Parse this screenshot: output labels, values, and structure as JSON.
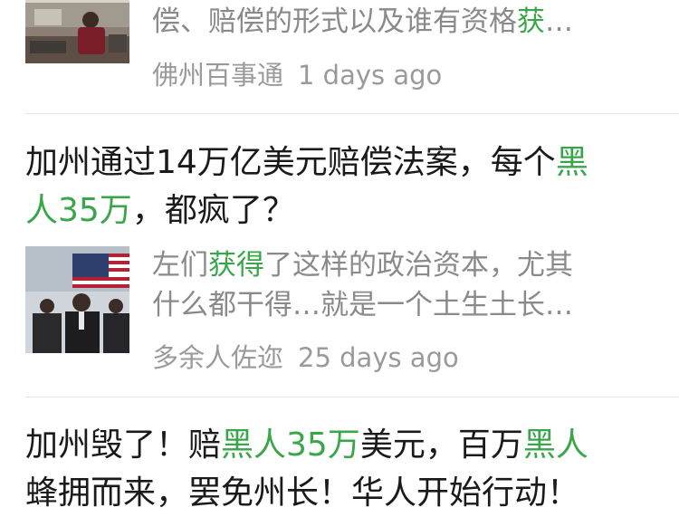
{
  "items": [
    {
      "snippet_lines": [
        [
          {
            "text": "偿、赔偿的形式以及谁有资格"
          },
          {
            "text": "获",
            "hl": true
          },
          {
            "text": "…"
          }
        ]
      ],
      "source": "佛州百事通",
      "time": "1 days ago"
    },
    {
      "title_lines": [
        [
          {
            "text": "加州通过14万亿美元赔偿法案，每个"
          },
          {
            "text": "黑",
            "hl": true
          }
        ],
        [
          {
            "text": "人35万",
            "hl": true
          },
          {
            "text": "，都疯了？"
          }
        ]
      ],
      "snippet_lines": [
        [
          {
            "text": "左们"
          },
          {
            "text": "获得",
            "hl": true
          },
          {
            "text": "了这样的政治资本，尤其"
          }
        ],
        [
          {
            "text": "什么都干得…就是一个土生土长…"
          }
        ]
      ],
      "source": "多余人佐迩",
      "time": "25 days ago"
    },
    {
      "title_lines": [
        [
          {
            "text": "加州毁了！赔"
          },
          {
            "text": "黑人35万",
            "hl": true
          },
          {
            "text": "美元，百万"
          },
          {
            "text": "黑人",
            "hl": true
          }
        ],
        [
          {
            "text": "蜂拥而来，罢免州长！华人开始行动！"
          }
        ]
      ]
    }
  ],
  "colors": {
    "highlight": "#3aa64a",
    "meta": "#9a9a9a",
    "snippet": "#8a8a8a",
    "title": "#1a1a1a"
  }
}
